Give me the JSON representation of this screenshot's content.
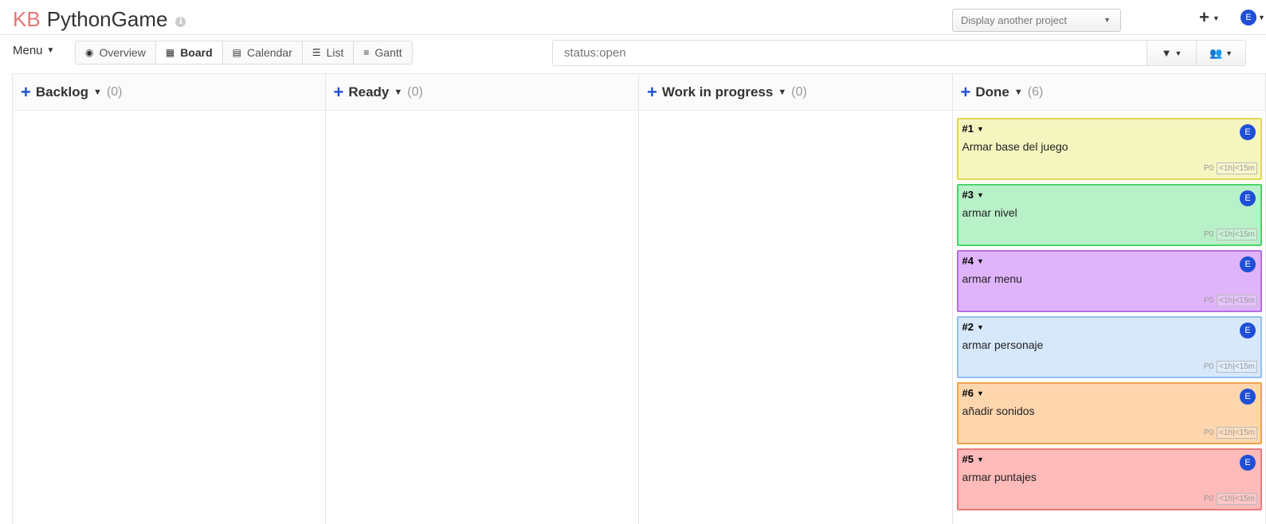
{
  "header": {
    "kb": "KB",
    "project_name": "PythonGame",
    "info_icon": "i",
    "project_select": "Display another project",
    "plus_icon": "+",
    "user_initial": "E"
  },
  "toolbar": {
    "menu_label": "Menu",
    "views": [
      {
        "label": "Overview",
        "icon": "eye-icon"
      },
      {
        "label": "Board",
        "icon": "grid-icon"
      },
      {
        "label": "Calendar",
        "icon": "calendar-icon"
      },
      {
        "label": "List",
        "icon": "list-icon"
      },
      {
        "label": "Gantt",
        "icon": "sliders-icon"
      }
    ],
    "search_value": "status:open"
  },
  "columns": [
    {
      "name": "Backlog",
      "count": "(0)"
    },
    {
      "name": "Ready",
      "count": "(0)"
    },
    {
      "name": "Work in progress",
      "count": "(0)"
    },
    {
      "name": "Done",
      "count": "(6)"
    }
  ],
  "tasks": [
    {
      "id": "#1",
      "title": "Armar base del juego",
      "priority": "P0",
      "time": "<1h|<15m",
      "avatar": "E",
      "color": "#f5f5c0",
      "border": "#e0d950"
    },
    {
      "id": "#3",
      "title": "armar nivel",
      "priority": "P0",
      "time": "<1h|<15m",
      "avatar": "E",
      "color": "#b8f0c8",
      "border": "#4cd36a"
    },
    {
      "id": "#4",
      "title": "armar menu",
      "priority": "P0",
      "time": "<1h|<15m",
      "avatar": "E",
      "color": "#dfb4fb",
      "border": "#b56ee0"
    },
    {
      "id": "#2",
      "title": "armar personaje",
      "priority": "P0",
      "time": "<1h|<15m",
      "avatar": "E",
      "color": "#d7e8fb",
      "border": "#94bff0"
    },
    {
      "id": "#6",
      "title": "añadir sonidos",
      "priority": "P0",
      "time": "<1h|<15m",
      "avatar": "E",
      "color": "#fed6ae",
      "border": "#f2a24a"
    },
    {
      "id": "#5",
      "title": "armar puntajes",
      "priority": "P0",
      "time": "<1h|<15m",
      "avatar": "E",
      "color": "#ffbaba",
      "border": "#ec7c7c"
    }
  ]
}
